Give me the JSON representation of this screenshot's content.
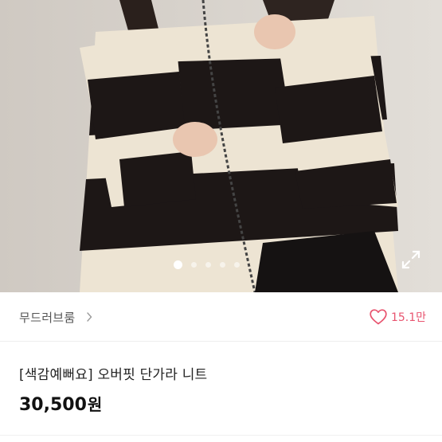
{
  "product": {
    "image_alt": "product-photo",
    "carousel": {
      "count": 5,
      "active_index": 0
    },
    "shop_name": "무드러브룸",
    "likes": "15.1만",
    "title": "[색감예뻐요] 오버핏 단가라 니트",
    "price": "30,500",
    "currency": "원"
  },
  "colors": {
    "accent": "#e8546f",
    "text_primary": "#111111",
    "text_secondary": "#555555"
  },
  "icons": [
    "expand-icon",
    "chevron-right-icon",
    "heart-icon"
  ]
}
